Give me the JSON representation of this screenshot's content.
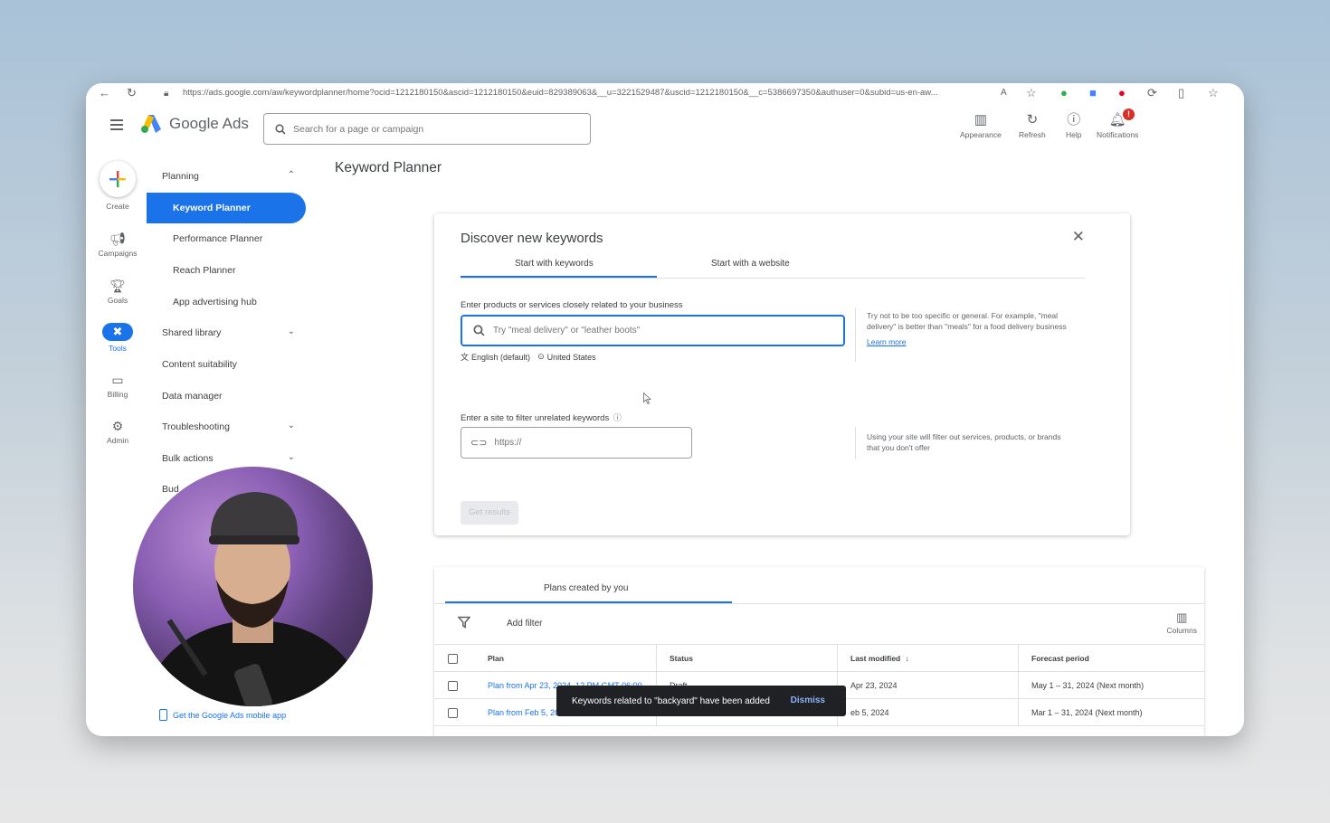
{
  "browser": {
    "url": "https://ads.google.com/aw/keywordplanner/home?ocid=1212180150&ascid=1212180150&euid=829389063&__u=3221529487&uscid=1212180150&__c=5386697350&authuser=0&subid=us-en-aw..."
  },
  "header": {
    "brand": "Google Ads",
    "search_placeholder": "Search for a page or campaign",
    "buttons": {
      "appearance": "Appearance",
      "refresh": "Refresh",
      "help": "Help",
      "notifications": "Notifications"
    },
    "notification_badge": "!"
  },
  "rail": {
    "create": "Create",
    "campaigns": "Campaigns",
    "goals": "Goals",
    "tools": "Tools",
    "billing": "Billing",
    "admin": "Admin"
  },
  "nav": {
    "planning": "Planning",
    "keyword_planner": "Keyword Planner",
    "performance_planner": "Performance Planner",
    "reach_planner": "Reach Planner",
    "app_advertising_hub": "App advertising hub",
    "shared_library": "Shared library",
    "content_suitability": "Content suitability",
    "data_manager": "Data manager",
    "troubleshooting": "Troubleshooting",
    "bulk_actions": "Bulk actions",
    "budgets_partial": "Bud",
    "mobile_app": "Get the Google Ads mobile app"
  },
  "page": {
    "title": "Keyword Planner"
  },
  "card": {
    "title": "Discover new keywords",
    "tab_keywords": "Start with keywords",
    "tab_website": "Start with a website",
    "keywords_label": "Enter products or services closely related to your business",
    "keywords_placeholder": "Try \"meal delivery\" or \"leather boots\"",
    "language": "English (default)",
    "location": "United States",
    "hint_keywords": "Try not to be too specific or general. For example, \"meal delivery\" is better than \"meals\" for a food delivery business",
    "learn_more": "Learn more",
    "site_label": "Enter a site to filter unrelated keywords",
    "site_placeholder": "https://",
    "hint_site": "Using your site will filter out services, products, or brands that you don't offer",
    "get_results": "Get results"
  },
  "plans": {
    "tab": "Plans created by you",
    "add_filter": "Add filter",
    "columns": "Columns",
    "headers": {
      "plan": "Plan",
      "status": "Status",
      "last_modified": "Last modified",
      "forecast_period": "Forecast period"
    },
    "rows": [
      {
        "plan": "Plan from Apr 23, 2024, 12 PM GMT-06:00",
        "status": "Draft",
        "modified": "Apr 23, 2024",
        "forecast": "May 1 – 31, 2024 (Next month)"
      },
      {
        "plan": "Plan from Feb 5, 20",
        "status": "",
        "modified": "eb 5, 2024",
        "forecast": "Mar 1 – 31, 2024 (Next month)"
      }
    ]
  },
  "toast": {
    "message": "Keywords related to \"backyard\" have been added",
    "dismiss": "Dismiss"
  },
  "colors": {
    "accent": "#1a73e8",
    "toast_bg": "#202124",
    "badge": "#d93025"
  }
}
